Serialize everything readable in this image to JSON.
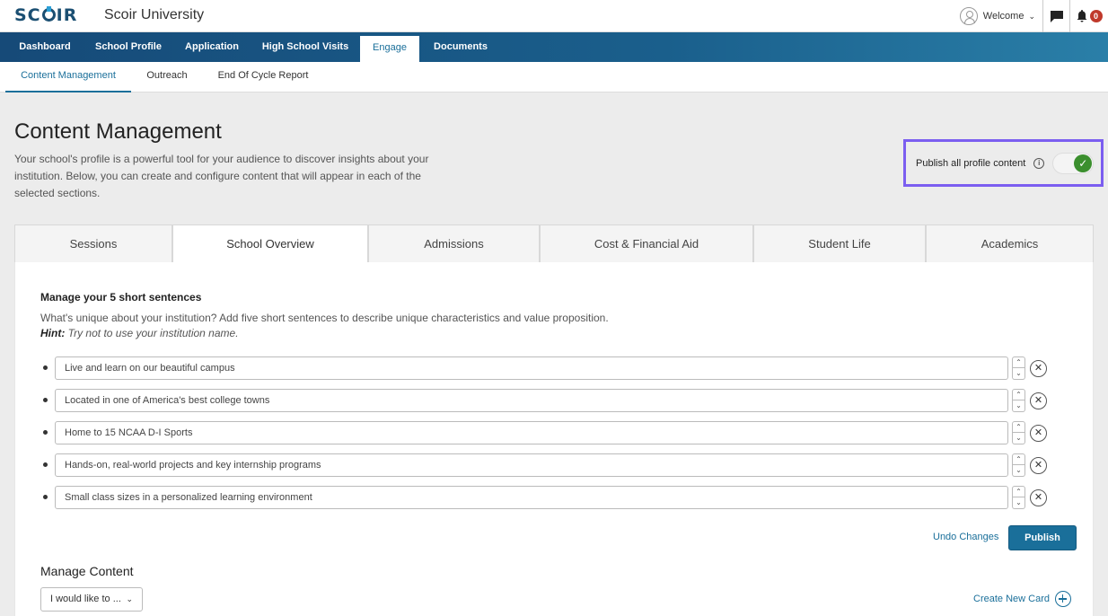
{
  "header": {
    "logo_text": "SCOIR",
    "university_name": "Scoir University",
    "welcome_label": "Welcome",
    "notification_count": "0"
  },
  "nav": {
    "items": [
      {
        "label": "Dashboard"
      },
      {
        "label": "School Profile"
      },
      {
        "label": "Application"
      },
      {
        "label": "High School Visits"
      },
      {
        "label": "Engage",
        "active": true
      },
      {
        "label": "Documents"
      }
    ]
  },
  "subnav": {
    "items": [
      {
        "label": "Content Management",
        "active": true
      },
      {
        "label": "Outreach"
      },
      {
        "label": "End Of Cycle Report"
      }
    ]
  },
  "page": {
    "title": "Content Management",
    "description": "Your school's profile is a powerful tool for your audience to discover insights about your institution. Below, you can create and configure content that will appear in each of the selected sections.",
    "publish_all_label": "Publish all profile content",
    "publish_all_enabled": true
  },
  "tabs": [
    {
      "label": "Sessions"
    },
    {
      "label": "School Overview",
      "active": true
    },
    {
      "label": "Admissions"
    },
    {
      "label": "Cost & Financial Aid"
    },
    {
      "label": "Student Life"
    },
    {
      "label": "Academics"
    }
  ],
  "sentences_section": {
    "title": "Manage your 5 short sentences",
    "description": "What's unique about your institution? Add five short sentences to describe unique characteristics and value proposition.",
    "hint_label": "Hint:",
    "hint_text": " Try not to use your institution name.",
    "sentences": [
      "Live and learn on our beautiful campus",
      "Located in one of America's best college towns",
      "Home to 15 NCAA D-I Sports",
      "Hands-on, real-world projects and key internship programs",
      "Small class sizes in a personalized learning environment"
    ],
    "undo_label": "Undo Changes",
    "publish_label": "Publish"
  },
  "content_section": {
    "title": "Manage Content",
    "dropdown_value": "I would like to ...",
    "create_card_label": "Create New Card"
  },
  "colors": {
    "brand": "#1a6f9a",
    "nav_dark": "#164a78",
    "highlight": "#7b5ef0",
    "toggle_on": "#3b8f2e",
    "badge": "#c0392b"
  }
}
